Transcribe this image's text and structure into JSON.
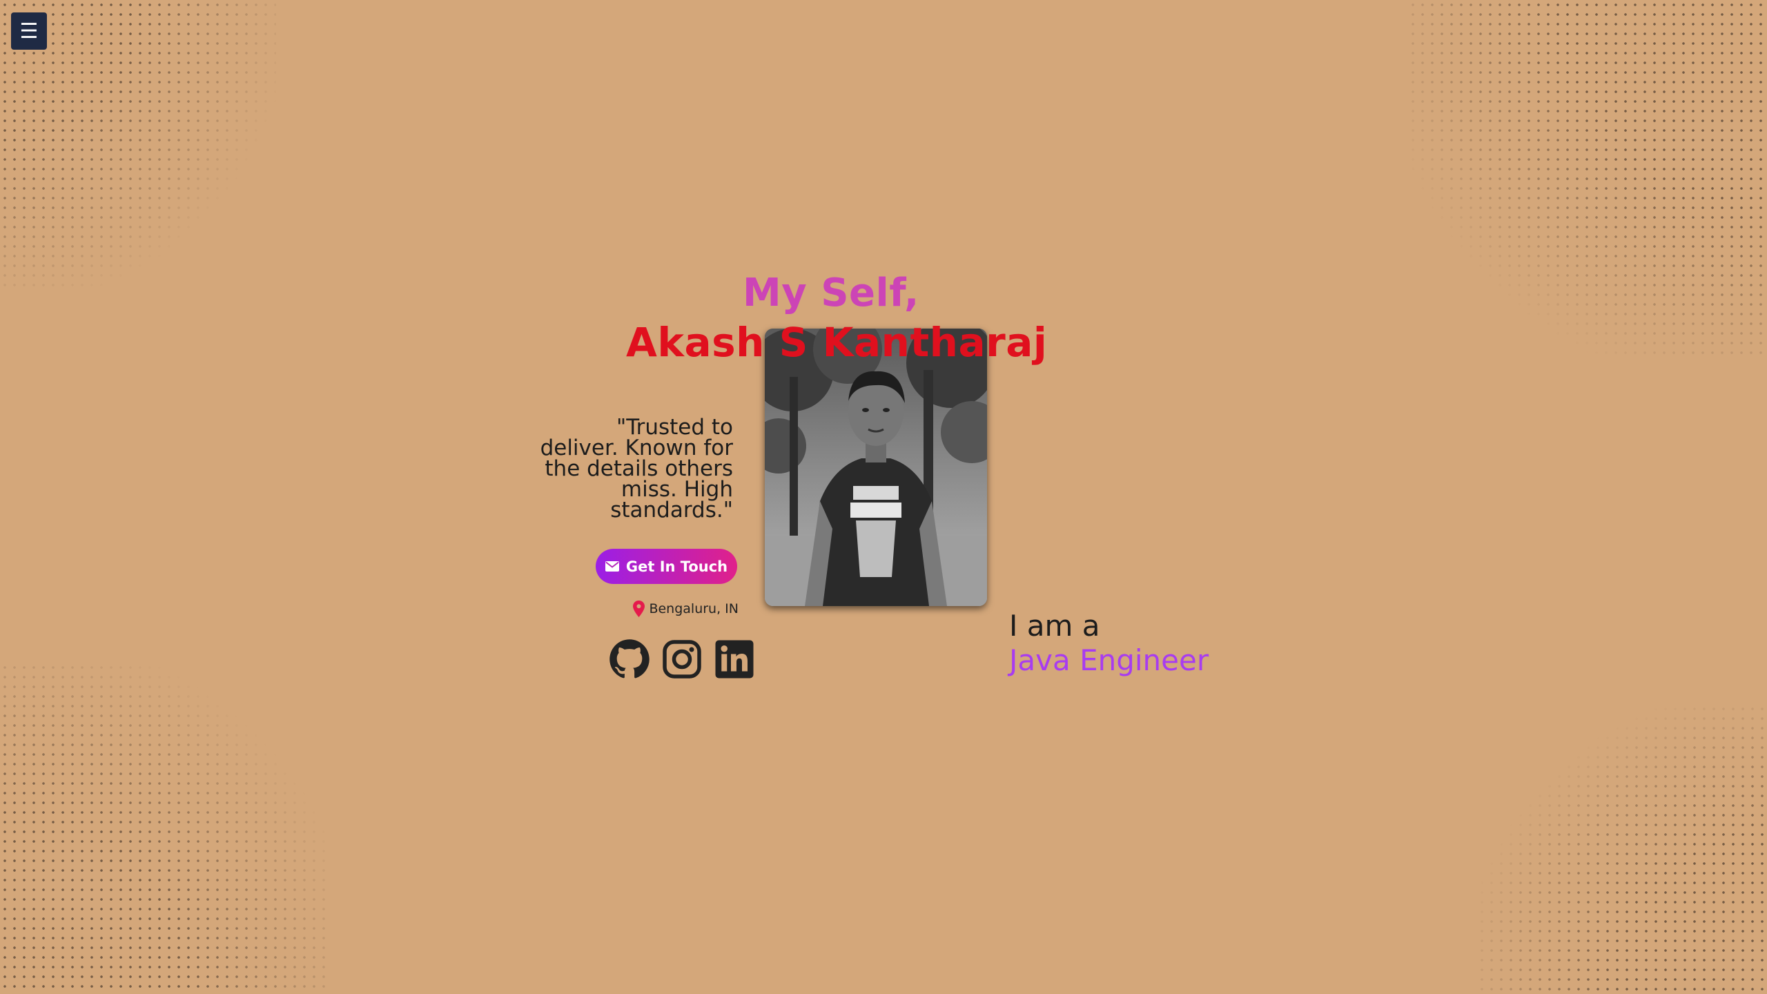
{
  "menu": {
    "icon": "hamburger-menu-icon",
    "glyph": "☰"
  },
  "hero": {
    "greeting": "My Self,",
    "name": "Akash S Kantharaj",
    "quote": "\"Trusted to deliver. Known for the details others miss. High standards.\"",
    "cta_label": "Get In Touch",
    "cta_icon": "envelope-icon",
    "location": "Bengaluru, IN",
    "location_icon": "map-pin-icon",
    "photo_alt": "Portrait of Akash S Kantharaj"
  },
  "social": [
    {
      "name": "github-icon"
    },
    {
      "name": "instagram-icon"
    },
    {
      "name": "linkedin-icon"
    }
  ],
  "typing": {
    "prefix": "I am a",
    "role": "Java Engineer"
  },
  "colors": {
    "background": "#d4a77a",
    "greeting": "#cc44b6",
    "name": "#e0101e",
    "role": "#a83cf0",
    "cta_gradient_start": "#9b1fe6",
    "cta_gradient_end": "#e0218a",
    "menu_bg": "#1f2a44"
  }
}
